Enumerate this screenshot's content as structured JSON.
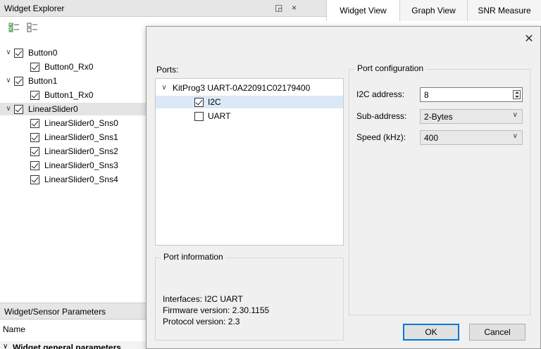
{
  "explorer": {
    "title": "Widget Explorer",
    "float_glyph": "◲",
    "close_glyph": "×",
    "tree": [
      {
        "label": "Button0",
        "level": 0,
        "checked": true,
        "expanded": true
      },
      {
        "label": "Button0_Rx0",
        "level": 1,
        "checked": true
      },
      {
        "label": "Button1",
        "level": 0,
        "checked": true,
        "expanded": true
      },
      {
        "label": "Button1_Rx0",
        "level": 1,
        "checked": true
      },
      {
        "label": "LinearSlider0",
        "level": 0,
        "checked": true,
        "expanded": true,
        "selected": true
      },
      {
        "label": "LinearSlider0_Sns0",
        "level": 1,
        "checked": true
      },
      {
        "label": "LinearSlider0_Sns1",
        "level": 1,
        "checked": true
      },
      {
        "label": "LinearSlider0_Sns2",
        "level": 1,
        "checked": true
      },
      {
        "label": "LinearSlider0_Sns3",
        "level": 1,
        "checked": true
      },
      {
        "label": "LinearSlider0_Sns4",
        "level": 1,
        "checked": true
      }
    ],
    "chevron_glyph": "∨"
  },
  "params": {
    "title": "Widget/Sensor Parameters",
    "name_header": "Name",
    "general_row": "Widget general parameters"
  },
  "tabs": [
    {
      "label": "Widget View",
      "active": true
    },
    {
      "label": "Graph View",
      "active": false
    },
    {
      "label": "SNR Measure",
      "active": false
    }
  ],
  "dialog": {
    "close_glyph": "✕",
    "ports_label": "Ports:",
    "ports": [
      {
        "label": "KitProg3 UART-0A22091C02179400",
        "level": 0,
        "expanded": true
      },
      {
        "label": "I2C",
        "level": 1,
        "checked": true,
        "selected": true
      },
      {
        "label": "UART",
        "level": 1,
        "checked": false
      }
    ],
    "port_info": {
      "title": "Port information",
      "interfaces": "Interfaces: I2C UART",
      "firmware": "Firmware version: 2.30.1155",
      "protocol": "Protocol version: 2.3"
    },
    "config": {
      "title": "Port configuration",
      "i2c_address_label": "I2C address:",
      "i2c_address_value": "8",
      "subaddress_label": "Sub-address:",
      "subaddress_value": "2-Bytes",
      "speed_label": "Speed (kHz):",
      "speed_value": "400"
    },
    "ok_label": "OK",
    "cancel_label": "Cancel"
  }
}
